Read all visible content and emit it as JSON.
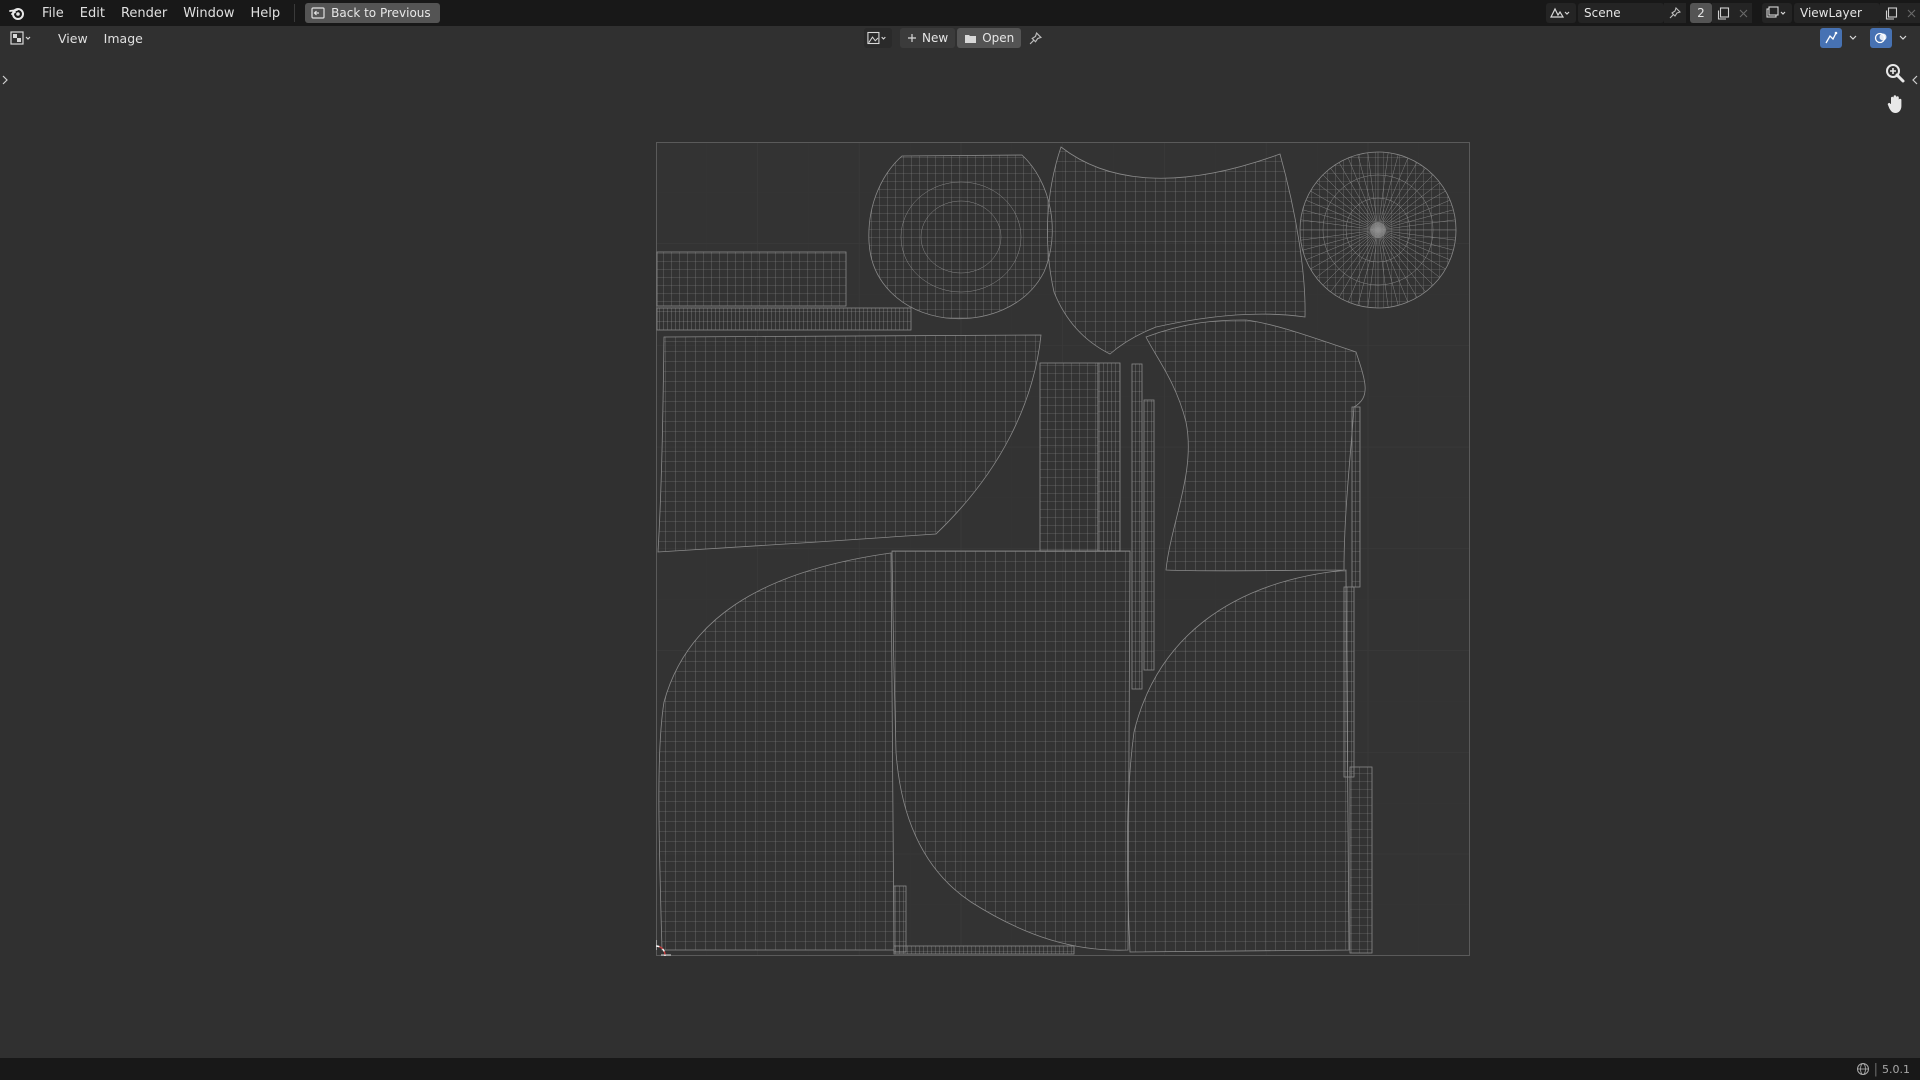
{
  "topbar": {
    "menu": [
      "File",
      "Edit",
      "Render",
      "Window",
      "Help"
    ],
    "back_button": "Back to Previous",
    "scene_name": "Scene",
    "scene_users": "2",
    "view_layer": "ViewLayer"
  },
  "image_editor": {
    "menus": [
      "View",
      "Image"
    ],
    "new_label": "New",
    "open_label": "Open"
  },
  "status_bar": {
    "version": "5.0.1"
  },
  "colors": {
    "background": "#303030",
    "topbar": "#181818",
    "uv_grid": "#3a3a3a",
    "uv_wire": "#8c8c8c",
    "accent_blue": "#4772b3"
  },
  "icons": [
    "blender-logo-icon",
    "back-icon",
    "scene-icon",
    "pin-icon",
    "copy-icon",
    "close-icon",
    "view-layer-icon",
    "image-editor-icon",
    "image-browse-icon",
    "plus-icon",
    "folder-icon",
    "uv-sync-icon",
    "overlay-icon",
    "zoom-icon",
    "hand-pan-icon",
    "cursor-2d-icon",
    "globe-icon"
  ]
}
